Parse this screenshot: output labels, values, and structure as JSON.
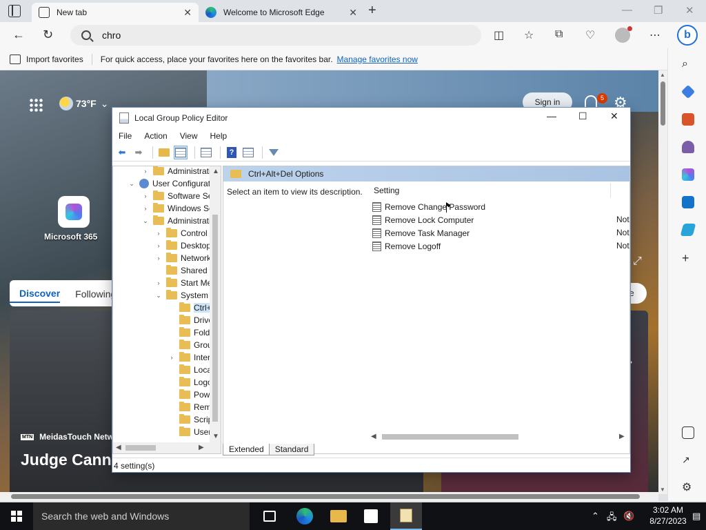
{
  "browser": {
    "tabs": [
      {
        "label": "New tab",
        "active": true
      },
      {
        "label": "Welcome to Microsoft Edge",
        "active": false
      }
    ],
    "address": {
      "value": "chro"
    },
    "favorites_bar": {
      "import_label": "Import favorites",
      "hint": "For quick access, place your favorites here on the favorites bar.",
      "manage_link": "Manage favorites now"
    }
  },
  "newtab": {
    "weather": "73°F",
    "sign_in": "Sign in",
    "notifications_count": "5",
    "tile_label": "Microsoft 365",
    "feed_tabs": [
      "Discover",
      "Following"
    ],
    "personalize_partial": "ze",
    "card": {
      "source": "MeidasTouch Netw",
      "source_logo": "MTN",
      "title": "Judge Cann Criminal Case"
    }
  },
  "gpedit": {
    "title": "Local Group Policy Editor",
    "menu": [
      "File",
      "Action",
      "View",
      "Help"
    ],
    "tree": [
      {
        "label": "Administrativ",
        "indent": 1,
        "twisty": "›",
        "icon": "folder"
      },
      {
        "label": "User Configuratio",
        "indent": 0,
        "twisty": "⌄",
        "icon": "user"
      },
      {
        "label": "Software Setti",
        "indent": 1,
        "twisty": "›",
        "icon": "folder"
      },
      {
        "label": "Windows Sett",
        "indent": 1,
        "twisty": "›",
        "icon": "folder"
      },
      {
        "label": "Administrative",
        "indent": 1,
        "twisty": "⌄",
        "icon": "folder"
      },
      {
        "label": "Control Pa",
        "indent": 2,
        "twisty": "›",
        "icon": "folder"
      },
      {
        "label": "Desktop",
        "indent": 2,
        "twisty": "›",
        "icon": "folder"
      },
      {
        "label": "Network",
        "indent": 2,
        "twisty": "›",
        "icon": "folder"
      },
      {
        "label": "Shared Fol",
        "indent": 2,
        "twisty": "",
        "icon": "folder"
      },
      {
        "label": "Start Menu",
        "indent": 2,
        "twisty": "›",
        "icon": "folder"
      },
      {
        "label": "System",
        "indent": 2,
        "twisty": "⌄",
        "icon": "folder"
      },
      {
        "label": "Ctrl+A",
        "indent": 3,
        "twisty": "",
        "icon": "folder",
        "selected": true
      },
      {
        "label": "Driver",
        "indent": 3,
        "twisty": "",
        "icon": "folder"
      },
      {
        "label": "Folder",
        "indent": 3,
        "twisty": "",
        "icon": "folder"
      },
      {
        "label": "Group",
        "indent": 3,
        "twisty": "",
        "icon": "folder"
      },
      {
        "label": "Interne",
        "indent": 3,
        "twisty": "›",
        "icon": "folder"
      },
      {
        "label": "Locale",
        "indent": 3,
        "twisty": "",
        "icon": "folder"
      },
      {
        "label": "Logon",
        "indent": 3,
        "twisty": "",
        "icon": "folder"
      },
      {
        "label": "Power",
        "indent": 3,
        "twisty": "",
        "icon": "folder"
      },
      {
        "label": "Remov",
        "indent": 3,
        "twisty": "",
        "icon": "folder"
      },
      {
        "label": "Scripts",
        "indent": 3,
        "twisty": "",
        "icon": "folder"
      },
      {
        "label": "User Pi",
        "indent": 3,
        "twisty": "",
        "icon": "folder"
      }
    ],
    "detail_header": "Ctrl+Alt+Del Options",
    "description": "Select an item to view its description.",
    "column_setting": "Setting",
    "settings": [
      {
        "name": "Remove Change Password",
        "state": ""
      },
      {
        "name": "Remove Lock Computer",
        "state": "Not"
      },
      {
        "name": "Remove Task Manager",
        "state": "Not"
      },
      {
        "name": "Remove Logoff",
        "state": "Not"
      }
    ],
    "view_tabs": [
      "Extended",
      "Standard"
    ],
    "status": "4 setting(s)"
  },
  "taskbar": {
    "search_placeholder": "Search the web and Windows",
    "time": "3:02 AM",
    "date": "8/27/2023"
  }
}
